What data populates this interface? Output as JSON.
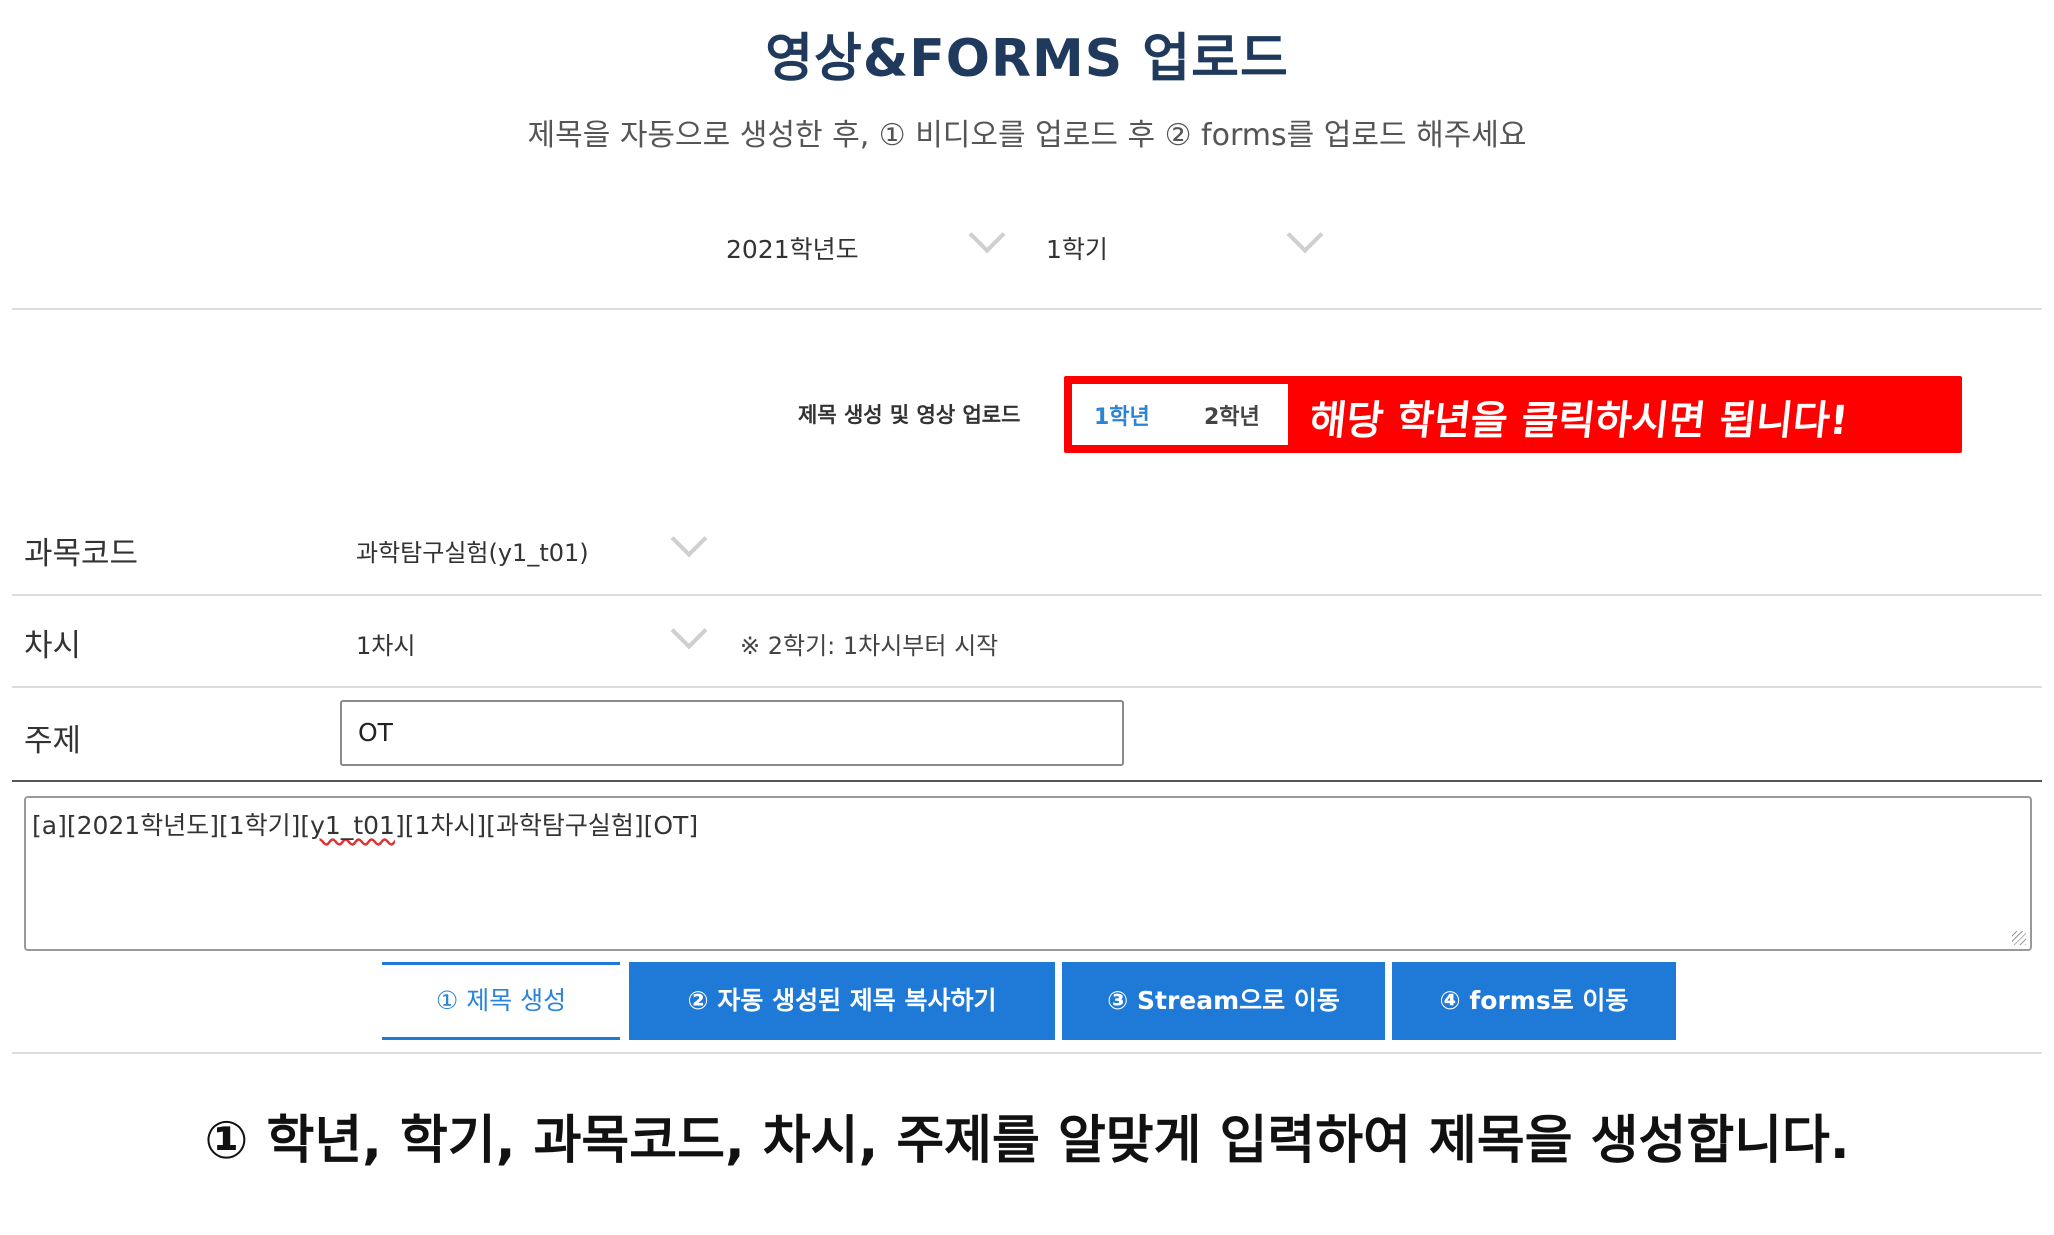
{
  "header": {
    "title": "영상&FORMS 업로드",
    "subtitle": "제목을 자동으로 생성한 후, ① 비디오를 업로드 후 ② forms를 업로드 해주세요"
  },
  "filters": {
    "year": "2021학년도",
    "semester": "1학기"
  },
  "grade_section": {
    "label": "제목 생성 및 영상 업로드",
    "tabs": [
      "1학년",
      "2학년"
    ],
    "active_tab": "1학년",
    "callout": "해당 학년을 클릭하시면 됩니다!"
  },
  "form": {
    "subject_label": "과목코드",
    "subject_value": "과학탐구실험(y1_t01)",
    "period_label": "차시",
    "period_value": "1차시",
    "period_note": "※ 2학기: 1차시부터 시작",
    "topic_label": "주제",
    "topic_value": "OT"
  },
  "generated_title": {
    "before": "[a][2021학년도][1학기][",
    "flagged": "y1_t01",
    "after": "][1차시][과학탐구실험][OT]"
  },
  "buttons": {
    "generate": "① 제목 생성",
    "copy": "② 자동 생성된 제목 복사하기",
    "stream": "③ Stream으로 이동",
    "forms": "④ forms로 이동"
  },
  "caption": "① 학년, 학기, 과목코드, 차시, 주제를 알맞게 입력하여 제목을 생성합니다.",
  "colors": {
    "title": "#1f3a5c",
    "accent_blue": "#1e7ad6",
    "callout_red": "#ff0000"
  }
}
